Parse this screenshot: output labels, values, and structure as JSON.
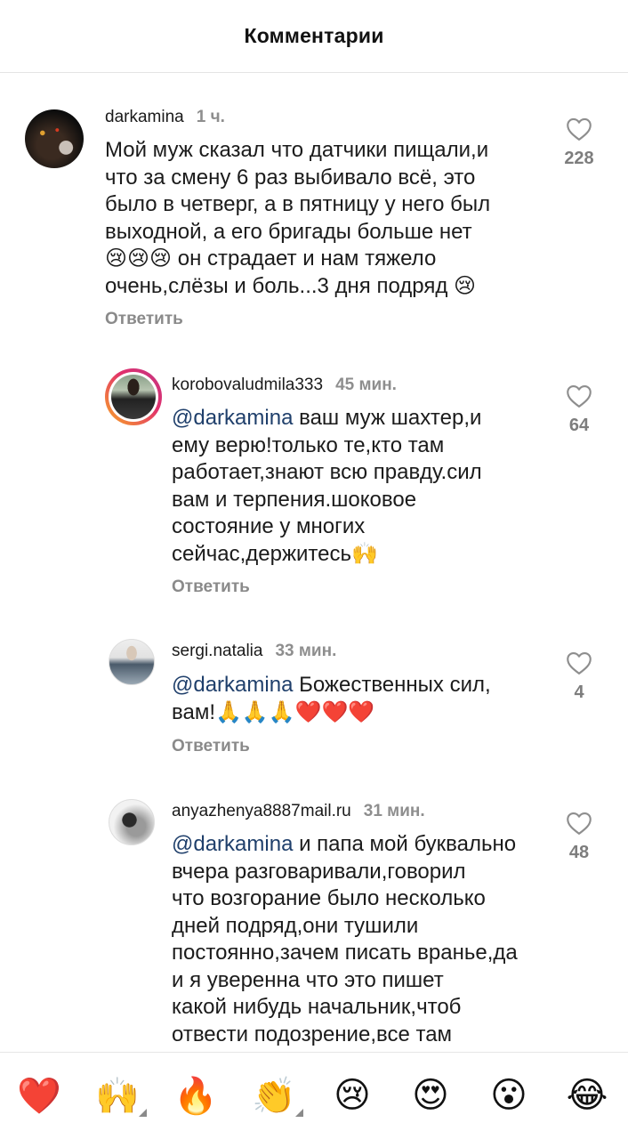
{
  "header": {
    "title": "Комментарии"
  },
  "comments": [
    {
      "username": "darkamina",
      "time": "1 ч.",
      "mention": "",
      "text": "Мой муж сказал что датчики пищали,и\nчто за смену 6 раз выбивало всё, это\nбыло в четверг, а в пятницу у него был\nвыходной, а его бригады больше нет\n😢😢😢 он страдает и нам тяжело\nочень,слёзы и боль...3 дня подряд 😢",
      "reply_label": "Ответить",
      "likes": "228"
    },
    {
      "username": "korobovaludmila333",
      "time": "45 мин.",
      "mention": "@darkamina",
      "text": " ваш муж шахтер,и\nему верю!только те,кто там\nработает,знают всю правду.сил\nвам и терпения.шоковое\nсостояние у многих\nсейчас,держитесь🙌",
      "reply_label": "Ответить",
      "likes": "64"
    },
    {
      "username": "sergi.natalia",
      "time": "33 мин.",
      "mention": "@darkamina",
      "text": " Божественных сил,\nвам!🙏🙏🙏❤️❤️❤️",
      "reply_label": "Ответить",
      "likes": "4"
    },
    {
      "username": "anyazhenya8887mail.ru",
      "time": "31 мин.",
      "mention": "@darkamina",
      "text": " и папа мой буквально\nвчера разговаривали,говорил\nчто возгорание было несколько\nдней подряд,они тушили\nпостоянно,зачем писать вранье,да\nи я уверенна что это пишет\nкакой нибудь начальник,чтоб\nотвести подозрение,все там",
      "reply_label": "Ответить",
      "likes": "48"
    }
  ],
  "reactions": [
    "❤️",
    "🙌",
    "🔥",
    "👏",
    "😢",
    "😍",
    "😮",
    "😂"
  ],
  "colors": {
    "mention": "#1f3f6b",
    "muted": "#8e8e8e",
    "story_ring_start": "#f9a825",
    "story_ring_end": "#d62976"
  }
}
